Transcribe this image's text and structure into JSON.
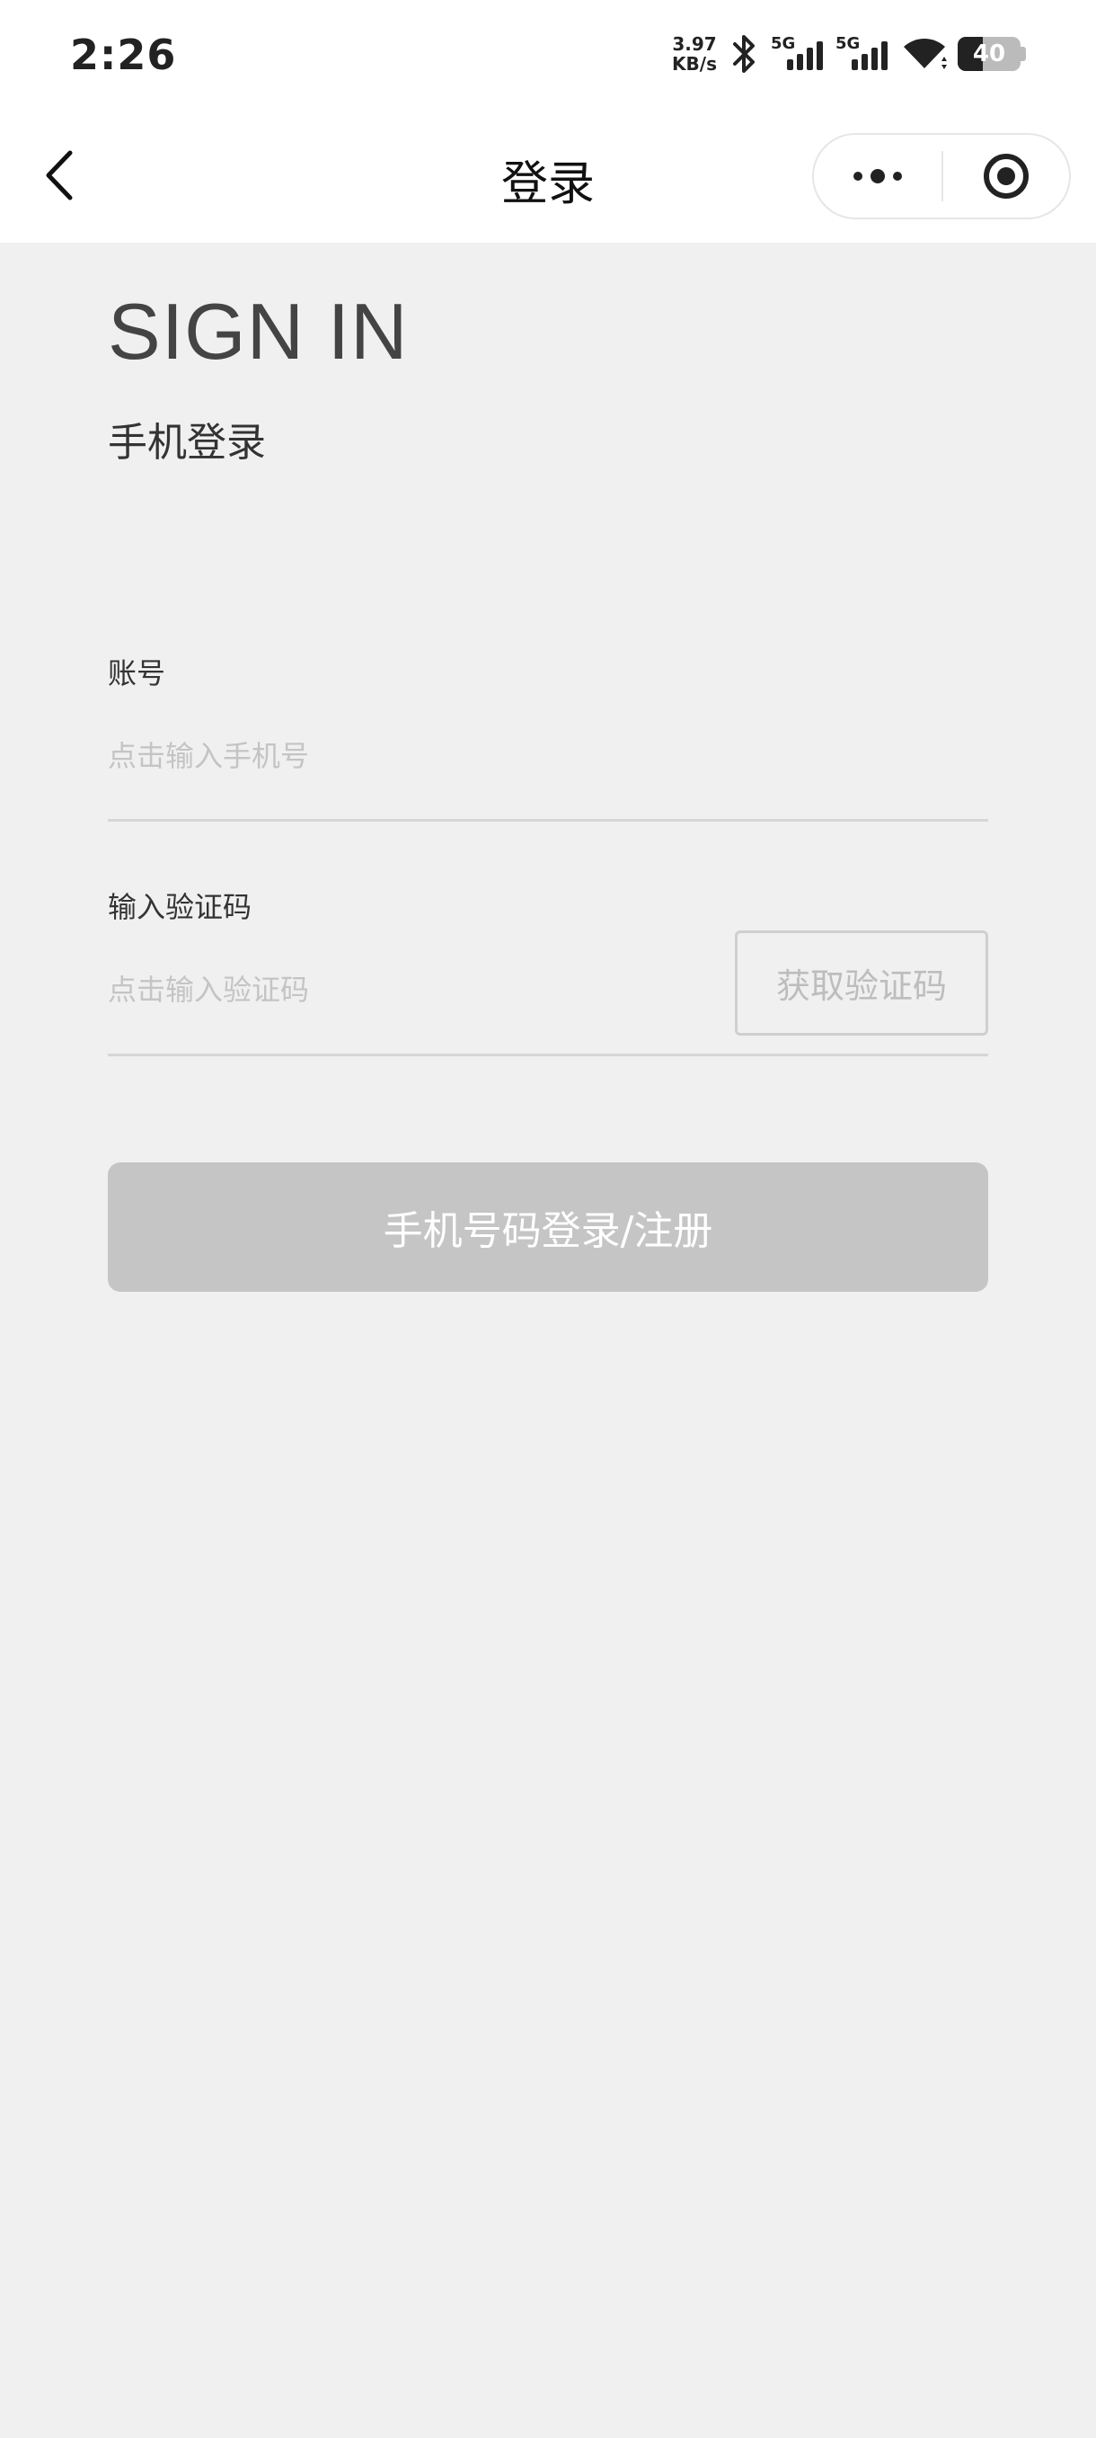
{
  "status_bar": {
    "time": "2:26",
    "net_speed_value": "3.97",
    "net_speed_unit": "KB/s",
    "sim1": "5G",
    "sim2": "5G",
    "battery": "40",
    "battery_level_percent": 40
  },
  "nav": {
    "title": "登录",
    "back_icon": "chevron-left-icon",
    "more_icon": "more-dots-icon",
    "close_icon": "target-circle-icon"
  },
  "header": {
    "title": "SIGN IN",
    "subtitle": "手机登录"
  },
  "form": {
    "account_label": "账号",
    "account_placeholder": "点击输入手机号",
    "code_label": "输入验证码",
    "code_placeholder": "点击输入验证码",
    "get_code_button": "获取验证码",
    "submit_button": "手机号码登录/注册"
  },
  "colors": {
    "page_background": "#f0f0f0",
    "submit_button_disabled": "#c5c5c5",
    "placeholder_text": "#c4c4c4"
  }
}
